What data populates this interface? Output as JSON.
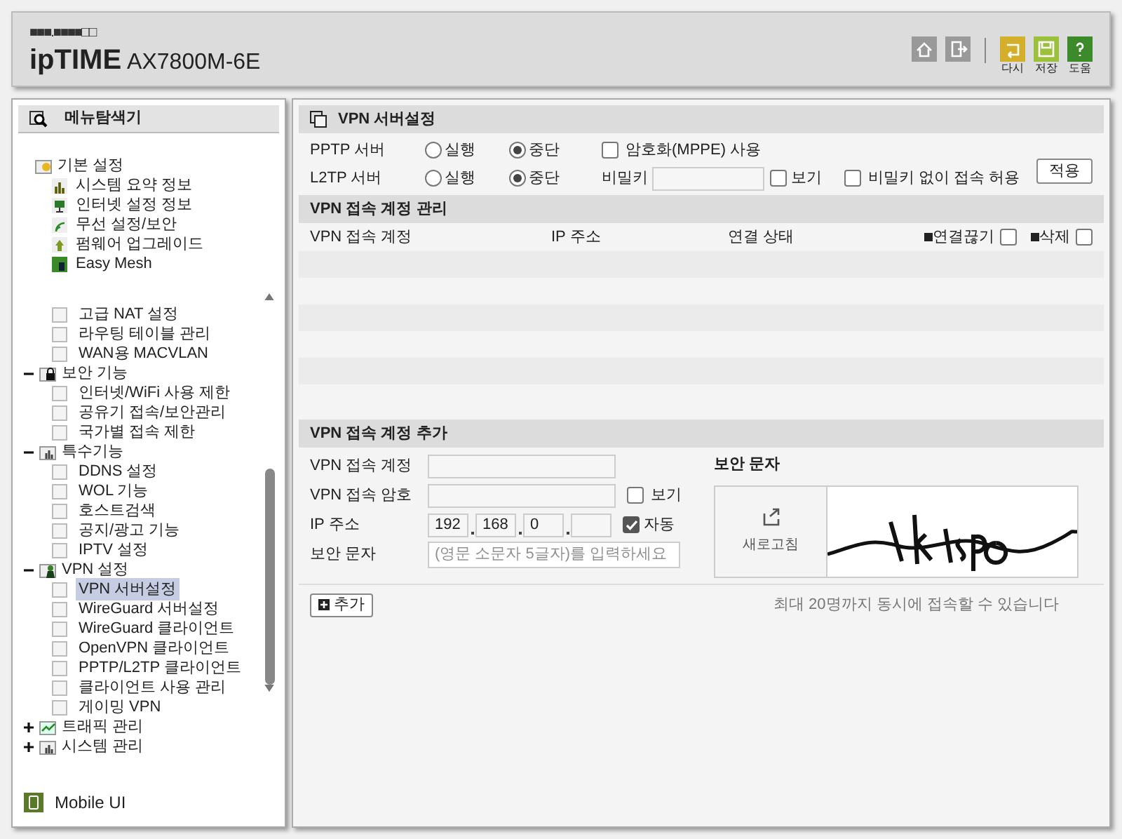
{
  "header": {
    "brand_dots": "■■■.■■■■□□",
    "brand": "ipTIME",
    "model": "AX7800M-6E",
    "actions": [
      {
        "kind": "home"
      },
      {
        "kind": "logout"
      },
      {
        "kind": "undo",
        "label": "다시"
      },
      {
        "kind": "save",
        "label": "저장"
      },
      {
        "kind": "help",
        "label": "도움"
      }
    ]
  },
  "sidebar": {
    "title": "메뉴탐색기",
    "top": {
      "label": "기본 설정",
      "children": [
        {
          "label": "시스템 요약 정보"
        },
        {
          "label": "인터넷 설정 정보"
        },
        {
          "label": "무선 설정/보안"
        },
        {
          "label": "펌웨어 업그레이드"
        },
        {
          "label": "Easy Mesh"
        }
      ]
    },
    "scrolled": [
      {
        "kind": "leaf",
        "label": "고급 NAT 설정",
        "selected": false
      },
      {
        "kind": "leaf",
        "label": "라우팅 테이블 관리",
        "selected": false
      },
      {
        "kind": "leaf",
        "label": "WAN용 MACVLAN",
        "selected": false
      },
      {
        "kind": "group",
        "label": "보안 기능",
        "expanded": true,
        "children": [
          {
            "label": "인터넷/WiFi 사용 제한",
            "selected": false
          },
          {
            "label": "공유기 접속/보안관리",
            "selected": false
          },
          {
            "label": "국가별 접속 제한",
            "selected": false
          }
        ]
      },
      {
        "kind": "group",
        "label": "특수기능",
        "expanded": true,
        "children": [
          {
            "label": "DDNS 설정",
            "selected": false
          },
          {
            "label": "WOL 기능",
            "selected": false
          },
          {
            "label": "호스트검색",
            "selected": false
          },
          {
            "label": "공지/광고 기능",
            "selected": false
          },
          {
            "label": "IPTV 설정",
            "selected": false
          }
        ]
      },
      {
        "kind": "group",
        "label": "VPN 설정",
        "expanded": true,
        "children": [
          {
            "label": "VPN 서버설정",
            "selected": true
          },
          {
            "label": "WireGuard 서버설정",
            "selected": false
          },
          {
            "label": "WireGuard 클라이언트",
            "selected": false
          },
          {
            "label": "OpenVPN 클라이언트",
            "selected": false
          },
          {
            "label": "PPTP/L2TP 클라이언트",
            "selected": false
          },
          {
            "label": "클라이언트 사용 관리",
            "selected": false
          },
          {
            "label": "게이밍 VPN",
            "selected": false
          }
        ]
      },
      {
        "kind": "group",
        "label": "트래픽 관리",
        "expanded": false
      },
      {
        "kind": "group",
        "label": "시스템 관리",
        "expanded": false
      }
    ],
    "mobile": "Mobile UI"
  },
  "vpn_server": {
    "title": "VPN 서버설정",
    "servers": [
      {
        "label": "PPTP 서버",
        "options": [
          {
            "label": "실행",
            "selected": false
          },
          {
            "label": "중단",
            "selected": true
          }
        ]
      },
      {
        "label": "L2TP 서버",
        "options": [
          {
            "label": "실행",
            "selected": false
          },
          {
            "label": "중단",
            "selected": true
          }
        ]
      }
    ],
    "mppe": {
      "label": "암호화(MPPE) 사용",
      "checked": false
    },
    "secret_label": "비밀키",
    "show_secret": {
      "label": "보기",
      "checked": false
    },
    "no_secret": {
      "label": "비밀키 없이 접속 허용",
      "checked": false
    },
    "apply": "적용"
  },
  "accounts": {
    "title": "VPN 접속 계정 관리",
    "columns": [
      "VPN 접속 계정",
      "IP 주소",
      "연결 상태"
    ],
    "disconnect": {
      "label": "연결끊기",
      "checked": false
    },
    "delete": {
      "label": "삭제",
      "checked": false
    }
  },
  "add_account": {
    "title": "VPN 접속 계정 추가",
    "account_label": "VPN 접속 계정",
    "password_label": "VPN 접속 암호",
    "show_password": {
      "label": "보기",
      "checked": false
    },
    "ip_label": "IP 주소",
    "ip": [
      "192",
      "168",
      "0"
    ],
    "auto": {
      "label": "자동",
      "checked": true
    },
    "captcha_label": "보안 문자",
    "captcha_placeholder": "(영문 소문자 5글자)를 입력하세요",
    "captcha_title": "보안 문자",
    "refresh": "새로고침"
  },
  "add_button": "추가",
  "note": "최대 20명까지 동시에 접속할 수 있습니다"
}
